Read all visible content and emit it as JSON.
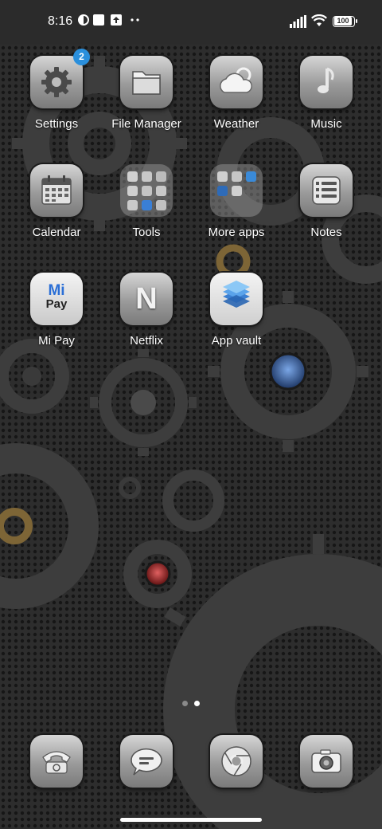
{
  "status_bar": {
    "time": "8:16",
    "battery": "100",
    "icons": [
      "notification-icon-1",
      "square-notification-icon",
      "upload-icon",
      "more-dots-icon",
      "signal-icon",
      "wifi-icon",
      "battery-icon"
    ]
  },
  "apps": [
    {
      "label": "Settings",
      "icon": "gear-icon",
      "badge": "2"
    },
    {
      "label": "File Manager",
      "icon": "folder-icon"
    },
    {
      "label": "Weather",
      "icon": "cloud-icon"
    },
    {
      "label": "Music",
      "icon": "music-note-icon"
    },
    {
      "label": "Calendar",
      "icon": "calendar-icon"
    },
    {
      "label": "Tools",
      "icon": "folder-tools-icon"
    },
    {
      "label": "More apps",
      "icon": "folder-more-apps-icon"
    },
    {
      "label": "Notes",
      "icon": "notes-icon"
    },
    {
      "label": "Mi Pay",
      "icon": "mi-pay-icon",
      "icon_text_top": "Mi",
      "icon_text_bottom": "Pay"
    },
    {
      "label": "Netflix",
      "icon": "netflix-icon",
      "icon_text": "N"
    },
    {
      "label": "App vault",
      "icon": "app-vault-icon"
    }
  ],
  "dock": [
    {
      "name": "phone",
      "icon": "phone-icon"
    },
    {
      "name": "messages",
      "icon": "message-icon"
    },
    {
      "name": "browser",
      "icon": "chrome-icon"
    },
    {
      "name": "camera",
      "icon": "camera-icon"
    }
  ],
  "page_indicator": {
    "pages": 2,
    "current": 2
  },
  "colors": {
    "badge": "#2a8fdc",
    "accent_gear_gold": "#8a7040",
    "jewel_blue": "#2e4f8a",
    "jewel_red": "#8a1e1e"
  }
}
